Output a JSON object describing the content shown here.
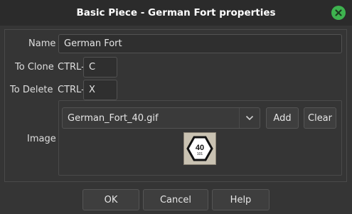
{
  "window": {
    "title": "Basic Piece - German Fort properties",
    "close_icon": "close-icon"
  },
  "form": {
    "name_label": "Name",
    "name_value": "German Fort",
    "clone_label": "To Clone",
    "clone_prefix": "CTRL-",
    "clone_key": "C",
    "delete_label": "To Delete",
    "delete_prefix": "CTRL-",
    "delete_key": "X"
  },
  "image": {
    "label": "Image",
    "selected_file": "German_Fort_40.gif",
    "add_label": "Add",
    "clear_label": "Clear",
    "preview": {
      "big": "40",
      "small": "101"
    }
  },
  "footer": {
    "ok_label": "OK",
    "cancel_label": "Cancel",
    "help_label": "Help"
  },
  "colors": {
    "accent_close": "#3eb34f",
    "background": "#353535",
    "titlebar": "#2b2b2b"
  }
}
